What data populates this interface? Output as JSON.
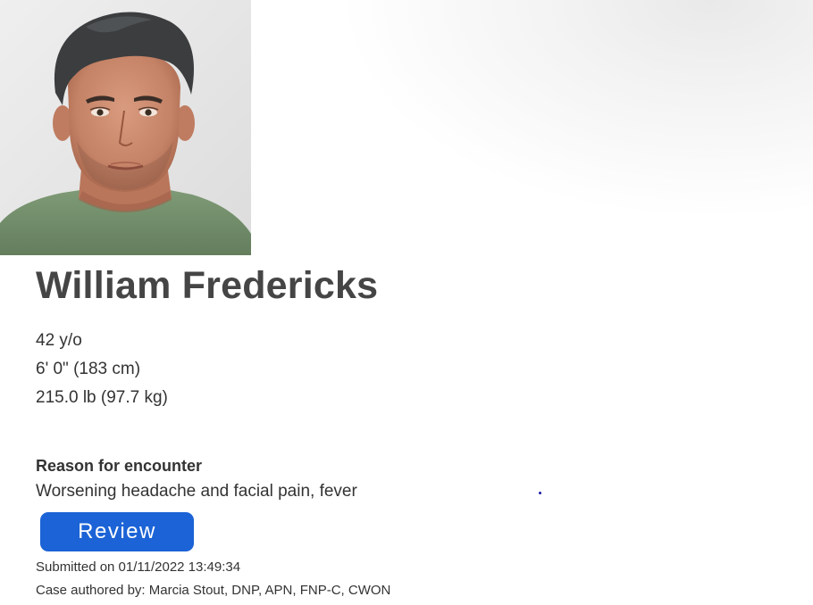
{
  "patient": {
    "name": "William Fredericks",
    "age": "42 y/o",
    "height": "6' 0\" (183 cm)",
    "weight": "215.0 lb (97.7 kg)"
  },
  "encounter": {
    "reason_heading": "Reason for encounter",
    "reason": "Worsening headache and facial pain, fever"
  },
  "actions": {
    "review_label": "Review"
  },
  "footer": {
    "submitted": "Submitted on 01/11/2022 13:49:34",
    "author": "Case authored by: Marcia Stout, DNP, APN, FNP-C, CWON"
  },
  "colors": {
    "primary_button": "#1b63d6",
    "heading_text": "#454545",
    "body_text": "#333333"
  }
}
